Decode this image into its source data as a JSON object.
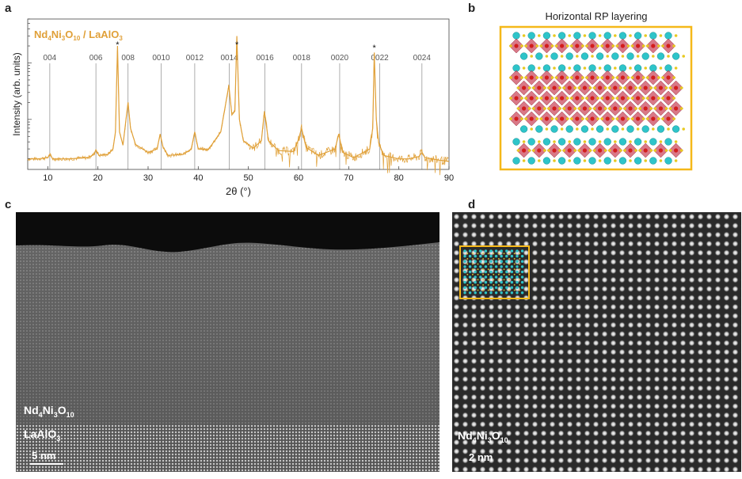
{
  "panels": {
    "a": {
      "letter": "a",
      "sample_label": "Nd4Ni3O10 / LaAlO3",
      "sample_label_parts": {
        "el1": "Nd",
        "n1": "4",
        "el2": "Ni",
        "n2": "3",
        "el3": "O",
        "n3": "10",
        "sep": " / ",
        "sub2a": "LaAlO",
        "sub2n": "3"
      },
      "peak_marker": "*",
      "reflections": [
        {
          "label": "004",
          "x": 10.4
        },
        {
          "label": "006",
          "x": 19.6
        },
        {
          "label": "008",
          "x": 26.0
        },
        {
          "label": "0010",
          "x": 32.6
        },
        {
          "label": "0012",
          "x": 39.3
        },
        {
          "label": "0014",
          "x": 46.2
        },
        {
          "label": "0016",
          "x": 53.3
        },
        {
          "label": "0018",
          "x": 60.6
        },
        {
          "label": "0020",
          "x": 68.2
        },
        {
          "label": "0022",
          "x": 76.2
        },
        {
          "label": "0024",
          "x": 84.6
        }
      ]
    },
    "b": {
      "letter": "b",
      "title": "Horizontal RP layering"
    },
    "c": {
      "letter": "c",
      "film_label": {
        "el1": "Nd",
        "n1": "4",
        "el2": "Ni",
        "n2": "3",
        "el3": "O",
        "n3": "10"
      },
      "substrate_label": {
        "el": "LaAlO",
        "n": "3"
      },
      "scale": "5 nm"
    },
    "d": {
      "letter": "d",
      "film_label": {
        "el1": "Nd",
        "n1": "4",
        "el2": "Ni",
        "n2": "3",
        "el3": "O",
        "n3": "10"
      },
      "scale": "2 nm"
    }
  },
  "colors": {
    "curve": "#e0a038",
    "inset_frame": "#f5b819",
    "nd": "#2ec4c9",
    "ni_octahedra": "#cc4b5f",
    "o": "#e8c920"
  },
  "chart_data": {
    "type": "line",
    "xlabel": "2θ (°)",
    "ylabel": "Intensity (arb. units)",
    "xlim": [
      6,
      90
    ],
    "y_scale": "log",
    "xticks": [
      10,
      20,
      30,
      40,
      50,
      60,
      70,
      80,
      90
    ],
    "series": [
      {
        "x": [
          6,
          8,
          10,
          10.4,
          11,
          14,
          18,
          19.2,
          19.6,
          20.2,
          22,
          23.0,
          23.5,
          23.9,
          24.3,
          25.0,
          25.6,
          26.0,
          26.5,
          27.5,
          30,
          31.8,
          32.4,
          33.0,
          34,
          37,
          38.6,
          39.3,
          40,
          42,
          44.5,
          45.6,
          46.1,
          46.7,
          47.3,
          47.7,
          48.2,
          49,
          51,
          52.6,
          53.2,
          54,
          56,
          59,
          60.0,
          60.6,
          61.5,
          64,
          67.3,
          68.0,
          68.8,
          71,
          74.2,
          74.8,
          75.1,
          75.5,
          76,
          77,
          80,
          82,
          84,
          84.6,
          85.2,
          88,
          90
        ],
        "y": [
          2.0,
          2.0,
          2.1,
          2.4,
          2.0,
          2.0,
          2.1,
          2.4,
          2.9,
          2.3,
          2.4,
          3.0,
          6.0,
          200,
          6.0,
          3.5,
          10,
          20,
          7,
          3.6,
          2.6,
          3.0,
          5.5,
          3.2,
          2.3,
          2.4,
          3.0,
          6.0,
          3.0,
          2.9,
          6.0,
          22,
          40,
          12,
          14,
          300,
          10,
          4.2,
          3.1,
          4.2,
          14,
          4.2,
          2.8,
          2.7,
          4.4,
          7.0,
          3.2,
          2.3,
          3.0,
          5.5,
          2.6,
          2.1,
          3.0,
          7.0,
          150,
          10,
          3.8,
          2.3,
          2.0,
          2.0,
          2.2,
          2.6,
          2.1,
          1.9,
          1.8
        ]
      }
    ]
  }
}
